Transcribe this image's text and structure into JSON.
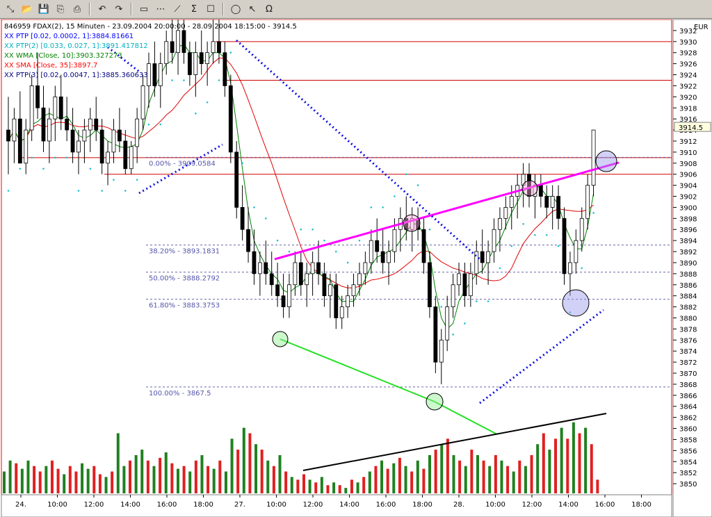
{
  "toolbar": {
    "buttons": [
      {
        "icon": "resize-icon",
        "glyph": "⤡"
      },
      {
        "icon": "open-folder-icon",
        "glyph": "📂"
      },
      {
        "icon": "save-icon",
        "glyph": "💾"
      },
      {
        "icon": "copy-icon",
        "glyph": "⎘"
      },
      {
        "icon": "print-icon",
        "glyph": "⎙"
      },
      {
        "icon": "undo-icon",
        "glyph": "↶"
      },
      {
        "icon": "redo-icon",
        "glyph": "↷"
      },
      {
        "icon": "chart-type-icon",
        "glyph": "▭"
      },
      {
        "icon": "indicator-icon",
        "glyph": "⋯"
      },
      {
        "icon": "draw-line-icon",
        "glyph": "⟋"
      },
      {
        "icon": "sigma-icon",
        "glyph": "Σ"
      },
      {
        "icon": "properties-icon",
        "glyph": "☐"
      },
      {
        "icon": "circle-icon",
        "glyph": "◯"
      },
      {
        "icon": "pointer-icon",
        "glyph": "↖"
      },
      {
        "icon": "magnet-icon",
        "glyph": "Ω"
      }
    ]
  },
  "chart_data": {
    "type": "candlestick",
    "title": "846959  FDAX(2), 15 Minuten - 23.09.2004 20:00:00 - 28.09.2004 18:15:00 - 3914.5",
    "currency": "EUR",
    "last_price_label": "3914.5",
    "last_price": 3914.5,
    "ylim": [
      3848,
      3934
    ],
    "y_ticks": [
      3850,
      3852,
      3854,
      3856,
      3858,
      3860,
      3862,
      3864,
      3866,
      3868,
      3870,
      3872,
      3874,
      3876,
      3878,
      3880,
      3882,
      3884,
      3886,
      3888,
      3890,
      3892,
      3894,
      3896,
      3898,
      3900,
      3902,
      3904,
      3906,
      3908,
      3910,
      3912,
      3914,
      3916,
      3918,
      3920,
      3922,
      3924,
      3926,
      3928,
      3930,
      3932
    ],
    "x_ticks": [
      "24.",
      "10:00",
      "12:00",
      "14:00",
      "16:00",
      "18:00",
      "27.",
      "10:00",
      "12:00",
      "14:00",
      "16:00",
      "18:00",
      "28.",
      "10:00",
      "12:00",
      "14:00",
      "16:00",
      "18:00"
    ],
    "legend": [
      {
        "text": "XX PTP [0.02, 0.0002, 1]:3884.81661",
        "color": "#0000ff"
      },
      {
        "text": "XX PTP(2) [0.033, 0.027, 1]:3891.417812",
        "color": "#00b0c0"
      },
      {
        "text": "XX WMA [Close, 10]:3903.327273",
        "color": "#008000"
      },
      {
        "text": "XX SMA [Close, 35]:3897.7",
        "color": "#ff0000"
      },
      {
        "text": "XX PTP(3) [0.02, 0.0047, 1]:3885.360633",
        "color": "#000080"
      }
    ],
    "fib_levels": [
      {
        "label": "0.00% - 3909.0584",
        "value": 3909.0584
      },
      {
        "label": "38.20% - 3893.1831",
        "value": 3893.1831
      },
      {
        "label": "50.00% - 3888.2792",
        "value": 3888.2792
      },
      {
        "label": "61.80% - 3883.3753",
        "value": 3883.3753
      },
      {
        "label": "100.00% - 3867.5",
        "value": 3867.5
      }
    ],
    "horizontal_lines": [
      3930,
      3923,
      3906,
      3909
    ],
    "candles": [
      [
        3914,
        3920,
        3906,
        3912
      ],
      [
        3912,
        3918,
        3908,
        3916
      ],
      [
        3916,
        3921,
        3910,
        3908
      ],
      [
        3908,
        3916,
        3906,
        3914
      ],
      [
        3914,
        3924,
        3912,
        3922
      ],
      [
        3922,
        3928,
        3916,
        3918
      ],
      [
        3918,
        3922,
        3910,
        3912
      ],
      [
        3912,
        3918,
        3908,
        3916
      ],
      [
        3916,
        3922,
        3912,
        3920
      ],
      [
        3920,
        3924,
        3914,
        3916
      ],
      [
        3916,
        3920,
        3912,
        3914
      ],
      [
        3914,
        3918,
        3908,
        3910
      ],
      [
        3910,
        3914,
        3906,
        3912
      ],
      [
        3912,
        3916,
        3908,
        3914
      ],
      [
        3914,
        3918,
        3910,
        3916
      ],
      [
        3916,
        3920,
        3912,
        3914
      ],
      [
        3914,
        3916,
        3906,
        3908
      ],
      [
        3908,
        3912,
        3904,
        3910
      ],
      [
        3910,
        3916,
        3908,
        3914
      ],
      [
        3914,
        3918,
        3910,
        3912
      ],
      [
        3912,
        3914,
        3906,
        3907
      ],
      [
        3907,
        3912,
        3906,
        3911
      ],
      [
        3911,
        3918,
        3908,
        3916
      ],
      [
        3916,
        3924,
        3914,
        3922
      ],
      [
        3922,
        3928,
        3918,
        3926
      ],
      [
        3926,
        3930,
        3920,
        3922
      ],
      [
        3922,
        3928,
        3918,
        3926
      ],
      [
        3926,
        3932,
        3924,
        3930
      ],
      [
        3930,
        3934,
        3926,
        3928
      ],
      [
        3928,
        3934,
        3924,
        3932
      ],
      [
        3932,
        3934,
        3926,
        3928
      ],
      [
        3928,
        3930,
        3922,
        3924
      ],
      [
        3924,
        3930,
        3920,
        3928
      ],
      [
        3928,
        3932,
        3924,
        3926
      ],
      [
        3926,
        3930,
        3922,
        3928
      ],
      [
        3928,
        3934,
        3926,
        3930
      ],
      [
        3930,
        3934,
        3926,
        3928
      ],
      [
        3928,
        3930,
        3920,
        3922
      ],
      [
        3922,
        3924,
        3908,
        3910
      ],
      [
        3910,
        3912,
        3898,
        3900
      ],
      [
        3900,
        3904,
        3894,
        3896
      ],
      [
        3896,
        3900,
        3890,
        3892
      ],
      [
        3892,
        3896,
        3886,
        3888
      ],
      [
        3888,
        3892,
        3884,
        3890
      ],
      [
        3890,
        3894,
        3886,
        3888
      ],
      [
        3888,
        3892,
        3884,
        3886
      ],
      [
        3886,
        3890,
        3882,
        3884
      ],
      [
        3884,
        3888,
        3880,
        3882
      ],
      [
        3882,
        3888,
        3880,
        3886
      ],
      [
        3886,
        3892,
        3884,
        3890
      ],
      [
        3890,
        3892,
        3884,
        3886
      ],
      [
        3886,
        3890,
        3882,
        3888
      ],
      [
        3888,
        3892,
        3884,
        3890
      ],
      [
        3890,
        3894,
        3886,
        3888
      ],
      [
        3888,
        3890,
        3882,
        3884
      ],
      [
        3884,
        3888,
        3880,
        3886
      ],
      [
        3886,
        3888,
        3878,
        3880
      ],
      [
        3880,
        3884,
        3878,
        3882
      ],
      [
        3882,
        3886,
        3880,
        3884
      ],
      [
        3884,
        3888,
        3882,
        3886
      ],
      [
        3886,
        3890,
        3884,
        3888
      ],
      [
        3888,
        3892,
        3886,
        3890
      ],
      [
        3890,
        3896,
        3888,
        3894
      ],
      [
        3894,
        3898,
        3890,
        3892
      ],
      [
        3892,
        3896,
        3888,
        3890
      ],
      [
        3890,
        3894,
        3886,
        3892
      ],
      [
        3892,
        3898,
        3890,
        3896
      ],
      [
        3896,
        3900,
        3892,
        3898
      ],
      [
        3898,
        3902,
        3894,
        3896
      ],
      [
        3896,
        3900,
        3892,
        3898
      ],
      [
        3898,
        3900,
        3894,
        3896
      ],
      [
        3896,
        3898,
        3888,
        3890
      ],
      [
        3890,
        3892,
        3880,
        3882
      ],
      [
        3882,
        3884,
        3870,
        3872
      ],
      [
        3872,
        3878,
        3868,
        3876
      ],
      [
        3876,
        3884,
        3874,
        3882
      ],
      [
        3882,
        3888,
        3880,
        3886
      ],
      [
        3886,
        3890,
        3884,
        3888
      ],
      [
        3888,
        3890,
        3882,
        3884
      ],
      [
        3884,
        3890,
        3882,
        3888
      ],
      [
        3888,
        3894,
        3886,
        3892
      ],
      [
        3892,
        3896,
        3888,
        3890
      ],
      [
        3890,
        3894,
        3886,
        3892
      ],
      [
        3892,
        3898,
        3890,
        3896
      ],
      [
        3896,
        3900,
        3892,
        3898
      ],
      [
        3898,
        3902,
        3896,
        3900
      ],
      [
        3900,
        3904,
        3896,
        3902
      ],
      [
        3902,
        3906,
        3898,
        3904
      ],
      [
        3904,
        3908,
        3900,
        3906
      ],
      [
        3906,
        3908,
        3900,
        3902
      ],
      [
        3902,
        3906,
        3898,
        3904
      ],
      [
        3904,
        3906,
        3900,
        3902
      ],
      [
        3902,
        3904,
        3898,
        3900
      ],
      [
        3900,
        3904,
        3896,
        3902
      ],
      [
        3902,
        3904,
        3896,
        3898
      ],
      [
        3898,
        3900,
        3886,
        3888
      ],
      [
        3888,
        3892,
        3884,
        3890
      ],
      [
        3890,
        3896,
        3888,
        3894
      ],
      [
        3894,
        3900,
        3892,
        3898
      ],
      [
        3898,
        3906,
        3896,
        3904
      ],
      [
        3904,
        3914,
        3902,
        3914
      ]
    ],
    "volume": [
      [
        8,
        "g"
      ],
      [
        12,
        "g"
      ],
      [
        11,
        "r"
      ],
      [
        9,
        "g"
      ],
      [
        12,
        "g"
      ],
      [
        10,
        "r"
      ],
      [
        8,
        "r"
      ],
      [
        10,
        "g"
      ],
      [
        12,
        "r"
      ],
      [
        9,
        "r"
      ],
      [
        7,
        "g"
      ],
      [
        10,
        "r"
      ],
      [
        8,
        "r"
      ],
      [
        11,
        "g"
      ],
      [
        9,
        "g"
      ],
      [
        10,
        "r"
      ],
      [
        7,
        "r"
      ],
      [
        6,
        "g"
      ],
      [
        8,
        "r"
      ],
      [
        22,
        "g"
      ],
      [
        10,
        "g"
      ],
      [
        12,
        "r"
      ],
      [
        14,
        "g"
      ],
      [
        16,
        "g"
      ],
      [
        12,
        "r"
      ],
      [
        10,
        "g"
      ],
      [
        13,
        "r"
      ],
      [
        15,
        "g"
      ],
      [
        11,
        "r"
      ],
      [
        9,
        "g"
      ],
      [
        10,
        "r"
      ],
      [
        8,
        "g"
      ],
      [
        12,
        "r"
      ],
      [
        14,
        "g"
      ],
      [
        10,
        "r"
      ],
      [
        9,
        "g"
      ],
      [
        12,
        "r"
      ],
      [
        8,
        "g"
      ],
      [
        20,
        "g"
      ],
      [
        16,
        "r"
      ],
      [
        24,
        "g"
      ],
      [
        22,
        "r"
      ],
      [
        18,
        "g"
      ],
      [
        16,
        "r"
      ],
      [
        12,
        "g"
      ],
      [
        10,
        "r"
      ],
      [
        14,
        "g"
      ],
      [
        8,
        "r"
      ],
      [
        6,
        "g"
      ],
      [
        5,
        "r"
      ],
      [
        7,
        "r"
      ],
      [
        5,
        "g"
      ],
      [
        4,
        "r"
      ],
      [
        6,
        "g"
      ],
      [
        3,
        "r"
      ],
      [
        4,
        "g"
      ],
      [
        3,
        "r"
      ],
      [
        2,
        "g"
      ],
      [
        5,
        "r"
      ],
      [
        4,
        "g"
      ],
      [
        6,
        "r"
      ],
      [
        8,
        "g"
      ],
      [
        10,
        "r"
      ],
      [
        12,
        "g"
      ],
      [
        9,
        "r"
      ],
      [
        11,
        "g"
      ],
      [
        13,
        "r"
      ],
      [
        10,
        "g"
      ],
      [
        8,
        "r"
      ],
      [
        12,
        "g"
      ],
      [
        9,
        "r"
      ],
      [
        14,
        "g"
      ],
      [
        16,
        "r"
      ],
      [
        18,
        "g"
      ],
      [
        20,
        "r"
      ],
      [
        14,
        "g"
      ],
      [
        12,
        "r"
      ],
      [
        10,
        "g"
      ],
      [
        16,
        "r"
      ],
      [
        14,
        "g"
      ],
      [
        12,
        "r"
      ],
      [
        10,
        "g"
      ],
      [
        14,
        "r"
      ],
      [
        12,
        "g"
      ],
      [
        10,
        "r"
      ],
      [
        8,
        "g"
      ],
      [
        12,
        "r"
      ],
      [
        10,
        "g"
      ],
      [
        14,
        "r"
      ],
      [
        18,
        "g"
      ],
      [
        22,
        "r"
      ],
      [
        16,
        "g"
      ],
      [
        20,
        "r"
      ],
      [
        24,
        "g"
      ],
      [
        20,
        "r"
      ],
      [
        26,
        "g"
      ],
      [
        22,
        "r"
      ],
      [
        24,
        "g"
      ],
      [
        18,
        "r"
      ],
      [
        5,
        "r"
      ]
    ]
  }
}
